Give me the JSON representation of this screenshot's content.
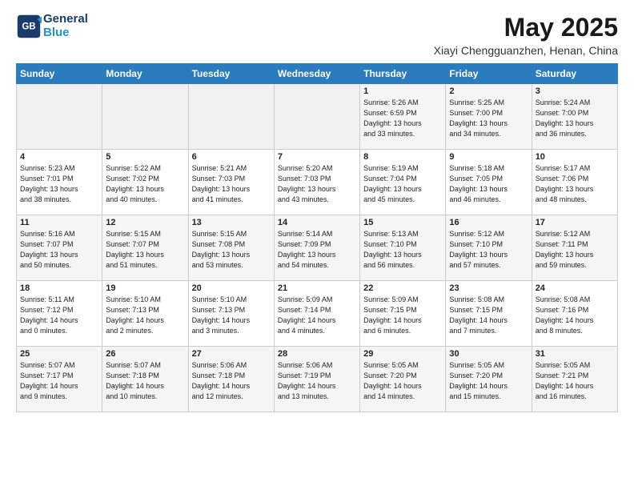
{
  "header": {
    "logo_line1": "General",
    "logo_line2": "Blue",
    "title": "May 2025",
    "subtitle": "Xiayi Chengguanzhen, Henan, China"
  },
  "weekdays": [
    "Sunday",
    "Monday",
    "Tuesday",
    "Wednesday",
    "Thursday",
    "Friday",
    "Saturday"
  ],
  "weeks": [
    [
      {
        "day": "",
        "info": ""
      },
      {
        "day": "",
        "info": ""
      },
      {
        "day": "",
        "info": ""
      },
      {
        "day": "",
        "info": ""
      },
      {
        "day": "1",
        "info": "Sunrise: 5:26 AM\nSunset: 6:59 PM\nDaylight: 13 hours\nand 33 minutes."
      },
      {
        "day": "2",
        "info": "Sunrise: 5:25 AM\nSunset: 7:00 PM\nDaylight: 13 hours\nand 34 minutes."
      },
      {
        "day": "3",
        "info": "Sunrise: 5:24 AM\nSunset: 7:00 PM\nDaylight: 13 hours\nand 36 minutes."
      }
    ],
    [
      {
        "day": "4",
        "info": "Sunrise: 5:23 AM\nSunset: 7:01 PM\nDaylight: 13 hours\nand 38 minutes."
      },
      {
        "day": "5",
        "info": "Sunrise: 5:22 AM\nSunset: 7:02 PM\nDaylight: 13 hours\nand 40 minutes."
      },
      {
        "day": "6",
        "info": "Sunrise: 5:21 AM\nSunset: 7:03 PM\nDaylight: 13 hours\nand 41 minutes."
      },
      {
        "day": "7",
        "info": "Sunrise: 5:20 AM\nSunset: 7:03 PM\nDaylight: 13 hours\nand 43 minutes."
      },
      {
        "day": "8",
        "info": "Sunrise: 5:19 AM\nSunset: 7:04 PM\nDaylight: 13 hours\nand 45 minutes."
      },
      {
        "day": "9",
        "info": "Sunrise: 5:18 AM\nSunset: 7:05 PM\nDaylight: 13 hours\nand 46 minutes."
      },
      {
        "day": "10",
        "info": "Sunrise: 5:17 AM\nSunset: 7:06 PM\nDaylight: 13 hours\nand 48 minutes."
      }
    ],
    [
      {
        "day": "11",
        "info": "Sunrise: 5:16 AM\nSunset: 7:07 PM\nDaylight: 13 hours\nand 50 minutes."
      },
      {
        "day": "12",
        "info": "Sunrise: 5:15 AM\nSunset: 7:07 PM\nDaylight: 13 hours\nand 51 minutes."
      },
      {
        "day": "13",
        "info": "Sunrise: 5:15 AM\nSunset: 7:08 PM\nDaylight: 13 hours\nand 53 minutes."
      },
      {
        "day": "14",
        "info": "Sunrise: 5:14 AM\nSunset: 7:09 PM\nDaylight: 13 hours\nand 54 minutes."
      },
      {
        "day": "15",
        "info": "Sunrise: 5:13 AM\nSunset: 7:10 PM\nDaylight: 13 hours\nand 56 minutes."
      },
      {
        "day": "16",
        "info": "Sunrise: 5:12 AM\nSunset: 7:10 PM\nDaylight: 13 hours\nand 57 minutes."
      },
      {
        "day": "17",
        "info": "Sunrise: 5:12 AM\nSunset: 7:11 PM\nDaylight: 13 hours\nand 59 minutes."
      }
    ],
    [
      {
        "day": "18",
        "info": "Sunrise: 5:11 AM\nSunset: 7:12 PM\nDaylight: 14 hours\nand 0 minutes."
      },
      {
        "day": "19",
        "info": "Sunrise: 5:10 AM\nSunset: 7:13 PM\nDaylight: 14 hours\nand 2 minutes."
      },
      {
        "day": "20",
        "info": "Sunrise: 5:10 AM\nSunset: 7:13 PM\nDaylight: 14 hours\nand 3 minutes."
      },
      {
        "day": "21",
        "info": "Sunrise: 5:09 AM\nSunset: 7:14 PM\nDaylight: 14 hours\nand 4 minutes."
      },
      {
        "day": "22",
        "info": "Sunrise: 5:09 AM\nSunset: 7:15 PM\nDaylight: 14 hours\nand 6 minutes."
      },
      {
        "day": "23",
        "info": "Sunrise: 5:08 AM\nSunset: 7:15 PM\nDaylight: 14 hours\nand 7 minutes."
      },
      {
        "day": "24",
        "info": "Sunrise: 5:08 AM\nSunset: 7:16 PM\nDaylight: 14 hours\nand 8 minutes."
      }
    ],
    [
      {
        "day": "25",
        "info": "Sunrise: 5:07 AM\nSunset: 7:17 PM\nDaylight: 14 hours\nand 9 minutes."
      },
      {
        "day": "26",
        "info": "Sunrise: 5:07 AM\nSunset: 7:18 PM\nDaylight: 14 hours\nand 10 minutes."
      },
      {
        "day": "27",
        "info": "Sunrise: 5:06 AM\nSunset: 7:18 PM\nDaylight: 14 hours\nand 12 minutes."
      },
      {
        "day": "28",
        "info": "Sunrise: 5:06 AM\nSunset: 7:19 PM\nDaylight: 14 hours\nand 13 minutes."
      },
      {
        "day": "29",
        "info": "Sunrise: 5:05 AM\nSunset: 7:20 PM\nDaylight: 14 hours\nand 14 minutes."
      },
      {
        "day": "30",
        "info": "Sunrise: 5:05 AM\nSunset: 7:20 PM\nDaylight: 14 hours\nand 15 minutes."
      },
      {
        "day": "31",
        "info": "Sunrise: 5:05 AM\nSunset: 7:21 PM\nDaylight: 14 hours\nand 16 minutes."
      }
    ]
  ]
}
